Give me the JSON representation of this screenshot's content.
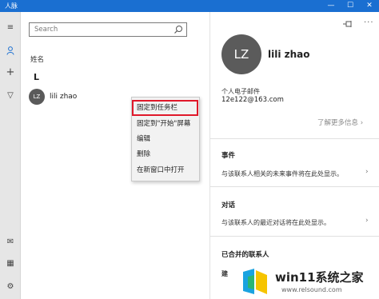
{
  "window": {
    "title": "人脉",
    "minimize_glyph": "—",
    "maximize_glyph": "☐",
    "close_glyph": "✕",
    "accent": "#1a6fd1"
  },
  "rail": {
    "items": [
      {
        "icon": "hamburger-menu-icon",
        "glyph": "≡"
      },
      {
        "icon": "person-icon",
        "glyph": "⚲"
      },
      {
        "icon": "add-icon",
        "glyph": "+"
      },
      {
        "icon": "filter-icon",
        "glyph": "▽"
      },
      {
        "icon": "mail-icon",
        "glyph": "✉"
      },
      {
        "icon": "calendar-icon",
        "glyph": "▦"
      },
      {
        "icon": "settings-icon",
        "glyph": "⚙"
      }
    ]
  },
  "list": {
    "search_placeholder": "Search",
    "sort_label": "姓名",
    "group_letter": "L",
    "contacts": [
      {
        "initials": "LZ",
        "name": "lili zhao"
      }
    ]
  },
  "context_menu": {
    "items": [
      {
        "label": "固定到任务栏",
        "highlighted": true
      },
      {
        "label": "固定到\"开始\"屏幕",
        "highlighted": false
      },
      {
        "label": "编辑",
        "highlighted": false
      },
      {
        "label": "删除",
        "highlighted": false
      },
      {
        "label": "在新窗口中打开",
        "highlighted": false
      }
    ],
    "highlight_color": "#e0182a"
  },
  "detail": {
    "initials": "LZ",
    "name": "lili zhao",
    "email_label": "个人电子邮件",
    "email": "12e122@163.com",
    "more_info": "了解更多信息 ›",
    "events_title": "事件",
    "events_text": "与该联系人相关的未来事件将在此处显示。",
    "conversations_title": "对话",
    "conversations_text": "与该联系人的最近对话将在此处显示。",
    "merged_title": "已合并的联系人",
    "merged_sub": "建",
    "arrow": "›"
  },
  "watermark": {
    "brand": "win11系统之家",
    "site": "www.relsound.com"
  }
}
